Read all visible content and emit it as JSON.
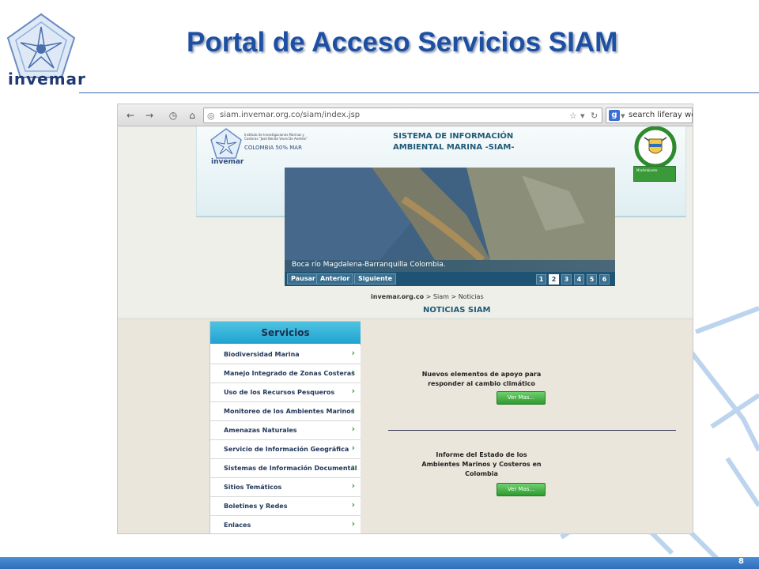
{
  "slide": {
    "title": "Portal de Acceso Servicios SIAM",
    "logo_text": "invemar",
    "page_number": "8"
  },
  "browser": {
    "url": "siam.invemar.org.co/siam/index.jsp",
    "search_placeholder": "search liferay web",
    "search_engine_icon": "google-icon",
    "nav_icons": [
      "back-arrow-icon",
      "forward-arrow-icon",
      "history-icon",
      "home-icon"
    ]
  },
  "site": {
    "header": {
      "inst_text": "Instituto de Investigaciones Marinas y Costeras \"José Benito Vives De Andréis\"",
      "colombia_text": "COLOMBIA 50% MAR",
      "mini_logo_word": "invemar",
      "siam_title_line1": "SISTEMA DE INFORMACIÓN",
      "siam_title_line2": "AMBIENTAL MARINA -SIAM-",
      "minamb_text": "MinAmbiente"
    },
    "banner": {
      "caption": "Boca río Magdalena-Barranquilla Colombia.",
      "controls": [
        "Pausar",
        "Anterior",
        "Siguiente"
      ],
      "pages": [
        "1",
        "2",
        "3",
        "4",
        "5",
        "6"
      ],
      "active_page": "2"
    },
    "breadcrumb": {
      "root": "invemar.org.co",
      "sep": ">",
      "path": "Siam > Noticias"
    },
    "news_section_title": "NOTICIAS SIAM",
    "services": {
      "heading": "Servicios",
      "items": [
        "Biodiversidad Marina",
        "Manejo Integrado de Zonas Costeras",
        "Uso de los Recursos Pesqueros",
        "Monitoreo de los Ambientes Marinos",
        "Amenazas Naturales",
        "Servicio de Información Geográfica",
        "Sistemas de Información Documental",
        "Sitios Temáticos",
        "Boletines y Redes",
        "Enlaces"
      ]
    },
    "news": [
      {
        "line1": "Nuevos elementos de apoyo para",
        "line2": "responder al cambio climático",
        "line3": "",
        "button": "Ver Mas..."
      },
      {
        "line1": "Informe del Estado de los",
        "line2": "Ambientes Marinos y Costeros en",
        "line3": "Colombia",
        "button": "Ver Mas..."
      }
    ]
  },
  "colors": {
    "title_blue": "#1d4fa3",
    "service_header": "#1fa3cf",
    "button_green": "#2f9a2f",
    "footer_blue": "#2f6fb8"
  }
}
